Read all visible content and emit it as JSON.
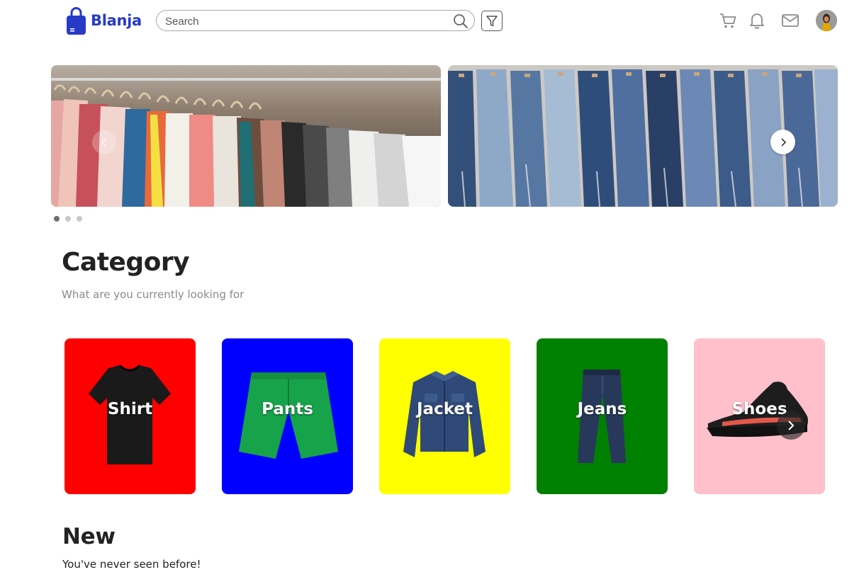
{
  "brand": {
    "name": "Blanja",
    "color": "#273ac7"
  },
  "search": {
    "placeholder": "Search",
    "value": ""
  },
  "header_icons": [
    "cart-icon",
    "bell-icon",
    "mail-icon"
  ],
  "carousel": {
    "slides": [
      {
        "subject": "hanging-shirts"
      },
      {
        "subject": "hanging-jeans"
      }
    ],
    "active_index": 0,
    "dot_count": 3
  },
  "category": {
    "title": "Category",
    "subtitle": "What are you currently looking for",
    "items": [
      {
        "label": "Shirt",
        "color": "#ff0000",
        "icon": "tshirt-icon"
      },
      {
        "label": "Pants",
        "color": "#0000ff",
        "icon": "shorts-icon"
      },
      {
        "label": "Jacket",
        "color": "#ffff00",
        "icon": "jacket-icon"
      },
      {
        "label": "Jeans",
        "color": "#008000",
        "icon": "jeans-icon"
      },
      {
        "label": "Shoes",
        "color": "#ffc0cb",
        "icon": "sneaker-icon"
      }
    ]
  },
  "new_section": {
    "title": "New",
    "subtitle": "You've never seen before!"
  }
}
